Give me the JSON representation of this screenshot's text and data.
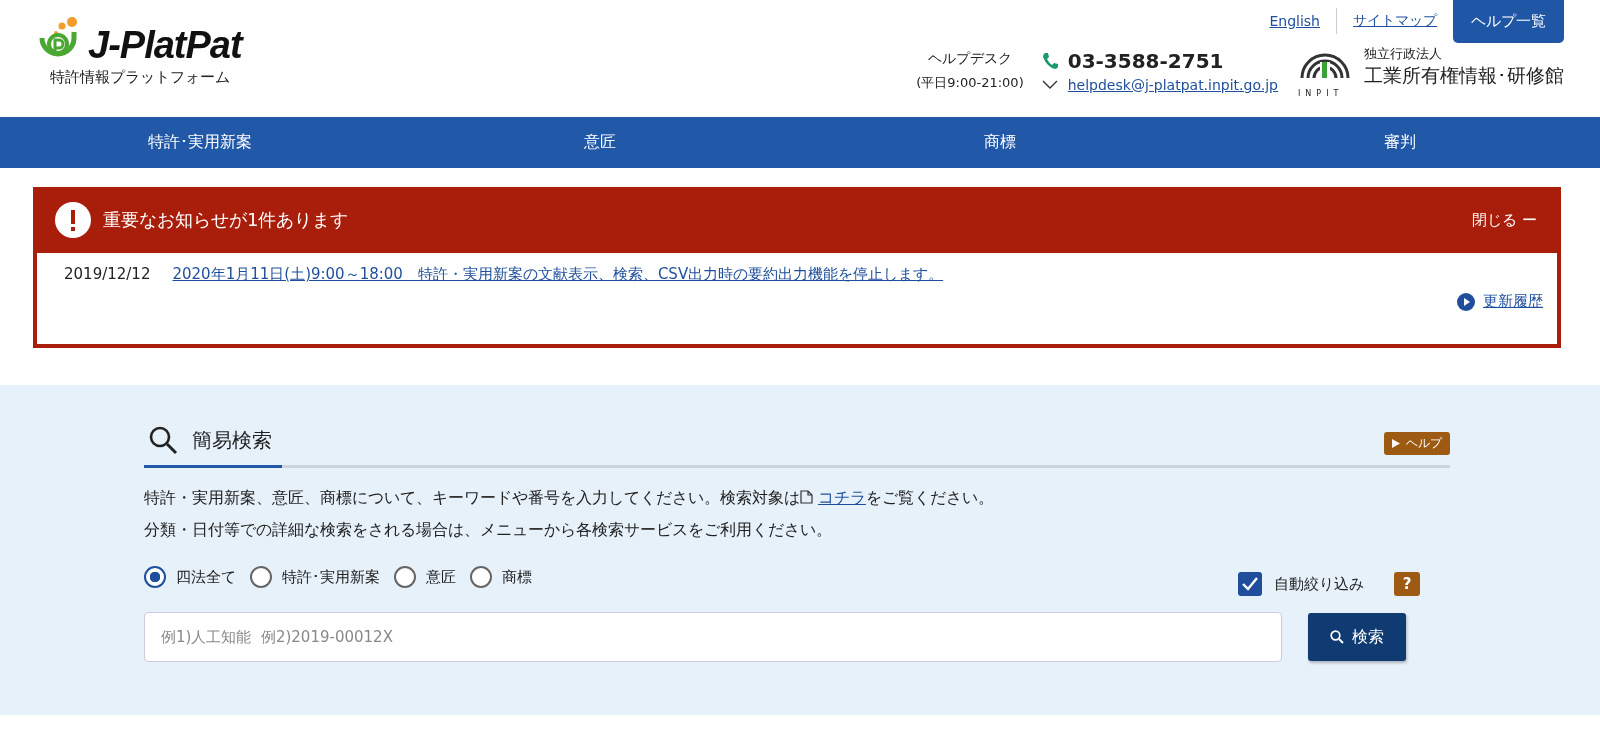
{
  "header": {
    "logo_text": "J-PlatPat",
    "logo_subtitle": "特許情報プラットフォーム",
    "links": [
      {
        "label": "English"
      },
      {
        "label": "サイトマップ"
      }
    ],
    "help_button": "ヘルプ一覧",
    "helpdesk": {
      "label": "ヘルプデスク",
      "hours": "(平日9:00-21:00)",
      "phone": "03-3588-2751",
      "email": "helpdesk@j-platpat.inpit.go.jp"
    },
    "org": {
      "mark_text": "INPIT",
      "type": "独立行政法人",
      "name": "工業所有権情報･研修館"
    }
  },
  "nav": [
    {
      "label": "特許･実用新案"
    },
    {
      "label": "意匠"
    },
    {
      "label": "商標"
    },
    {
      "label": "審判"
    }
  ],
  "notice": {
    "title": "重要なお知らせが1件あります",
    "close": "閉じる ー",
    "items": [
      {
        "date": "2019/12/12",
        "text": "2020年1月11日(土)9:00～18:00　特許・実用新案の文献表示、検索、CSV出力時の要約出力機能を停止します。"
      }
    ],
    "history_link": "更新履歴"
  },
  "search": {
    "title": "簡易検索",
    "help": "ヘルプ",
    "description": [
      {
        "before": "特許・実用新案、意匠、商標について、キーワードや番号を入力してください。検索対象は",
        "link": "コチラ",
        "after": "をご覧ください。"
      },
      {
        "before": "分類・日付等での詳細な検索をされる場合は、メニューから各検索サービスをご利用ください。"
      }
    ],
    "targets": [
      {
        "label": "四法全て",
        "selected": true
      },
      {
        "label": "特許･実用新案",
        "selected": false
      },
      {
        "label": "意匠",
        "selected": false
      },
      {
        "label": "商標",
        "selected": false
      }
    ],
    "auto_filter": {
      "label": "自動絞り込み",
      "checked": true
    },
    "hint_icon": "?",
    "placeholder": "例1)人工知能  例2)2019-00012X",
    "button": "検索"
  }
}
